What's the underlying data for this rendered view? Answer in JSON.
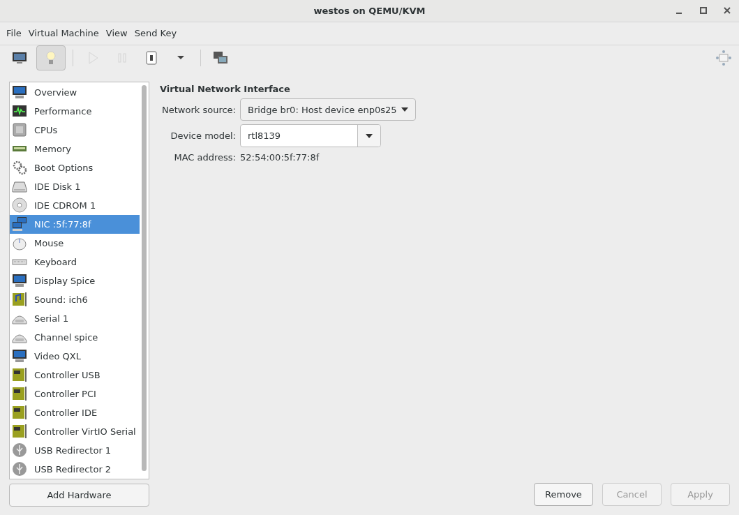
{
  "window": {
    "title": "westos on QEMU/KVM"
  },
  "menu": [
    "File",
    "Virtual Machine",
    "View",
    "Send Key"
  ],
  "toolbar": [
    [
      {
        "kind": "monitor",
        "selected": false,
        "disabled": false
      },
      {
        "kind": "bulb",
        "selected": true,
        "disabled": false
      }
    ],
    [
      {
        "kind": "play",
        "selected": false,
        "disabled": true
      },
      {
        "kind": "pause",
        "selected": false,
        "disabled": true
      },
      {
        "kind": "power",
        "selected": false,
        "disabled": false
      },
      {
        "kind": "caret",
        "selected": false,
        "disabled": false
      }
    ],
    [
      {
        "kind": "screens",
        "selected": false,
        "disabled": false
      }
    ]
  ],
  "sidebar": {
    "items": [
      {
        "label": "Overview",
        "kind": "monitor",
        "selected": false
      },
      {
        "label": "Performance",
        "kind": "chart",
        "selected": false
      },
      {
        "label": "CPUs",
        "kind": "chip",
        "selected": false
      },
      {
        "label": "Memory",
        "kind": "memory",
        "selected": false
      },
      {
        "label": "Boot Options",
        "kind": "gears",
        "selected": false
      },
      {
        "label": "IDE Disk 1",
        "kind": "disk",
        "selected": false
      },
      {
        "label": "IDE CDROM 1",
        "kind": "cdrom",
        "selected": false
      },
      {
        "label": "NIC :5f:77:8f",
        "kind": "network",
        "selected": true
      },
      {
        "label": "Mouse",
        "kind": "mouse",
        "selected": false
      },
      {
        "label": "Keyboard",
        "kind": "keyboard",
        "selected": false
      },
      {
        "label": "Display Spice",
        "kind": "monitor",
        "selected": false
      },
      {
        "label": "Sound: ich6",
        "kind": "sound",
        "selected": false
      },
      {
        "label": "Serial 1",
        "kind": "serial",
        "selected": false
      },
      {
        "label": "Channel spice",
        "kind": "serial",
        "selected": false
      },
      {
        "label": "Video QXL",
        "kind": "monitor",
        "selected": false
      },
      {
        "label": "Controller USB",
        "kind": "card",
        "selected": false
      },
      {
        "label": "Controller PCI",
        "kind": "card",
        "selected": false
      },
      {
        "label": "Controller IDE",
        "kind": "card",
        "selected": false
      },
      {
        "label": "Controller VirtIO Serial",
        "kind": "card",
        "selected": false
      },
      {
        "label": "USB Redirector 1",
        "kind": "usb",
        "selected": false
      },
      {
        "label": "USB Redirector 2",
        "kind": "usb",
        "selected": false
      }
    ],
    "add_button": "Add Hardware"
  },
  "details": {
    "heading": "Virtual Network Interface",
    "network_source": {
      "label": "Network source:",
      "value": "Bridge br0: Host device enp0s25"
    },
    "device_model": {
      "label": "Device model:",
      "value": "rtl8139"
    },
    "mac": {
      "label": "MAC address:",
      "value": "52:54:00:5f:77:8f"
    }
  },
  "buttons": [
    {
      "label": "Remove",
      "disabled": false
    },
    {
      "label": "Cancel",
      "disabled": true
    },
    {
      "label": "Apply",
      "disabled": true
    }
  ]
}
